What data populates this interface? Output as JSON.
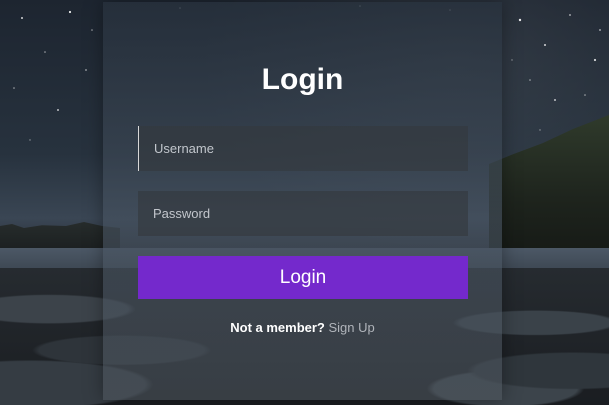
{
  "login_form": {
    "title": "Login",
    "username_placeholder": "Username",
    "password_placeholder": "Password",
    "submit_label": "Login",
    "member_prompt": "Not a member?",
    "signup_link": "Sign Up"
  },
  "colors": {
    "accent": "#7429cc",
    "text_primary": "#ffffff",
    "link_muted": "#b0b4ba"
  }
}
